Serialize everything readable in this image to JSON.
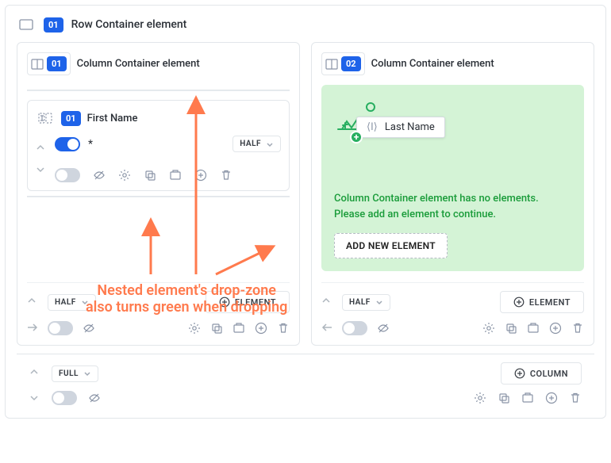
{
  "row": {
    "index": "01",
    "title": "Row Container element",
    "width_label": "FULL",
    "add_column_label": "COLUMN"
  },
  "columns": [
    {
      "index": "01",
      "title": "Column Container element",
      "width_label": "HALF",
      "add_element_label": "ELEMENT",
      "field": {
        "index": "01",
        "title": "First Name",
        "required_marker": "*",
        "width_label": "HALF"
      }
    },
    {
      "index": "02",
      "title": "Column Container element",
      "width_label": "HALF",
      "add_element_label": "ELEMENT",
      "dropzone": {
        "drag_label": "Last Name",
        "empty_text": "Column Container element has no elements. Please add an element to continue.",
        "add_label": "ADD NEW ELEMENT"
      }
    }
  ],
  "annotation": {
    "line1": "Nested element's drop-zone",
    "line2": "also turns green when dropping"
  },
  "icons": {
    "row": "row-icon",
    "column": "column-icon",
    "text_input": "text-input-icon"
  }
}
